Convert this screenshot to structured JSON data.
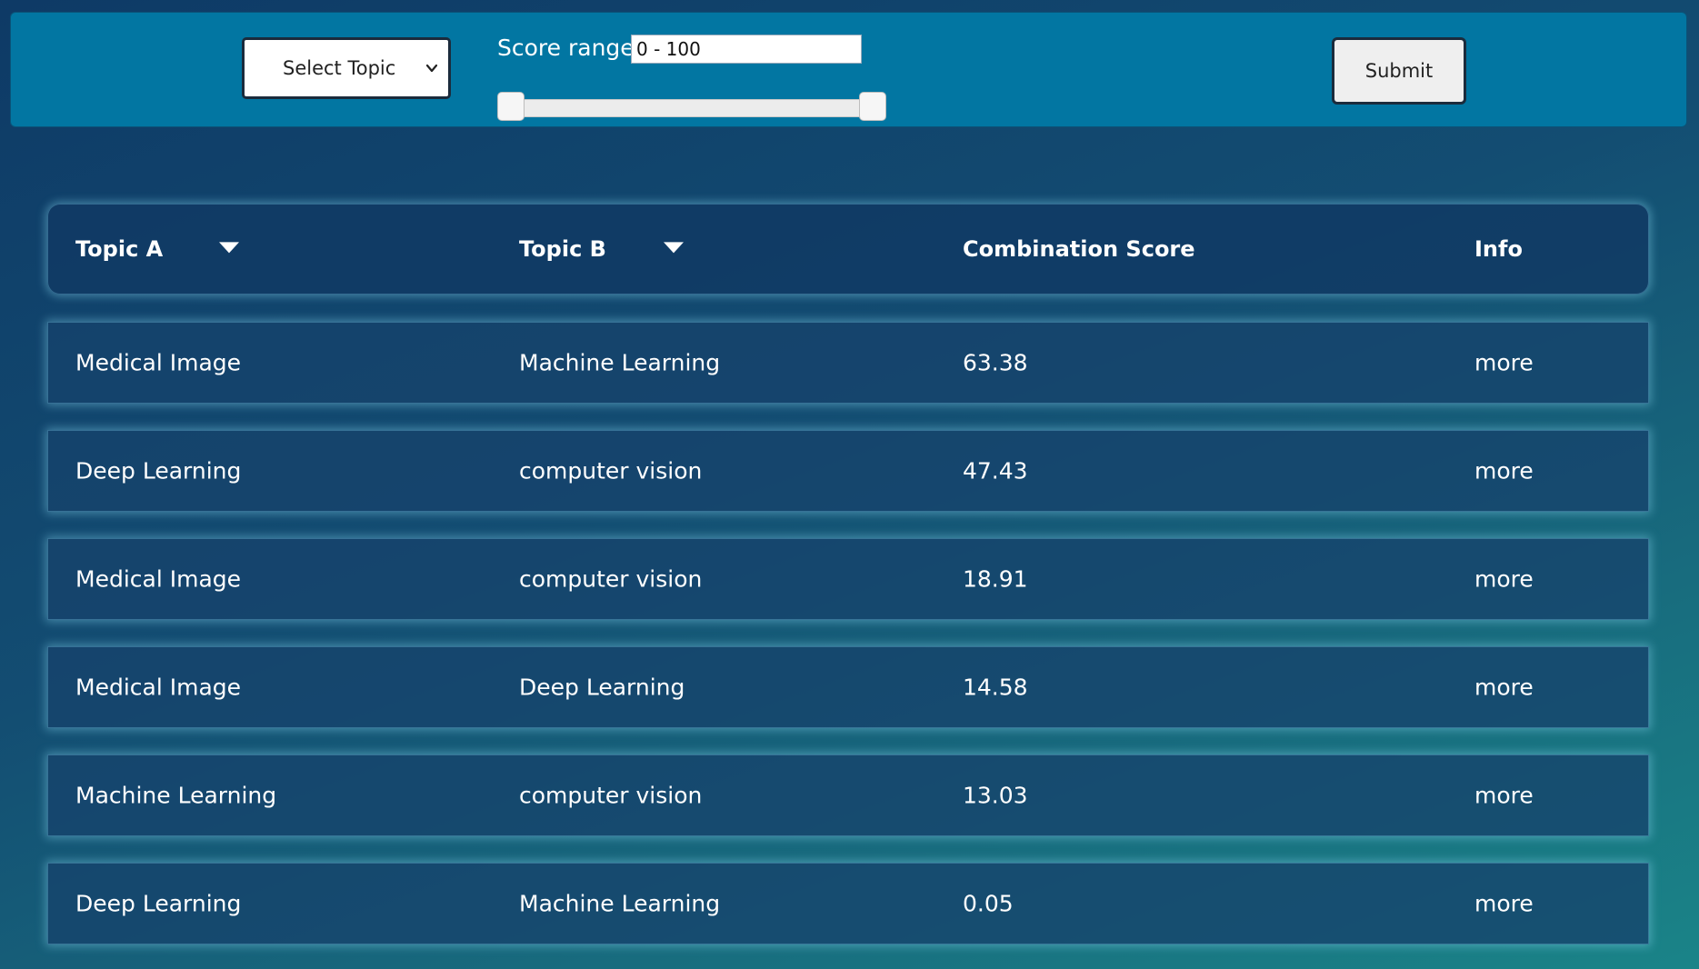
{
  "toolbar": {
    "topic_select": {
      "selected": "Select Topic"
    },
    "score_range": {
      "label": "Score range:",
      "value": "0 - 100",
      "min": 0,
      "max": 100
    },
    "submit_label": "Submit"
  },
  "table": {
    "headers": {
      "topic_a": "Topic A",
      "topic_b": "Topic B",
      "score": "Combination Score",
      "info": "Info"
    },
    "rows": [
      {
        "topic_a": "Medical Image",
        "topic_b": "Machine Learning",
        "score": "63.38",
        "info": "more"
      },
      {
        "topic_a": "Deep Learning",
        "topic_b": "computer vision",
        "score": "47.43",
        "info": "more"
      },
      {
        "topic_a": "Medical Image",
        "topic_b": "computer vision",
        "score": "18.91",
        "info": "more"
      },
      {
        "topic_a": "Medical Image",
        "topic_b": "Deep Learning",
        "score": "14.58",
        "info": "more"
      },
      {
        "topic_a": "Machine Learning",
        "topic_b": "computer vision",
        "score": "13.03",
        "info": "more"
      },
      {
        "topic_a": "Deep Learning",
        "topic_b": "Machine Learning",
        "score": "0.05",
        "info": "more"
      }
    ]
  },
  "colors": {
    "toolbar_bg": "#0276a2",
    "page_gradient_start": "#0e3a66",
    "page_gradient_end": "#1a8488",
    "row_glow": "#82d2eb"
  },
  "icons": {
    "select_chevron": "chevron-down-icon",
    "sort": "caret-down-icon"
  }
}
